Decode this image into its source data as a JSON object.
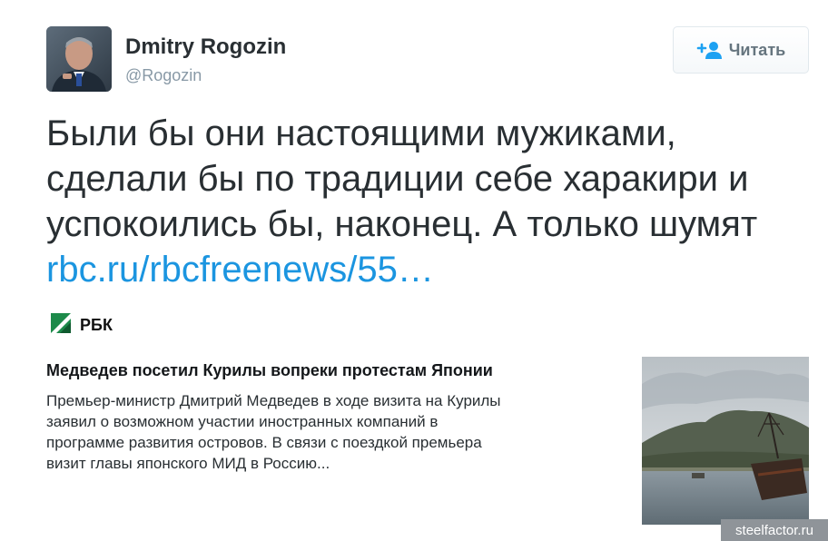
{
  "profile": {
    "display_name": "Dmitry Rogozin",
    "handle": "@Rogozin"
  },
  "follow_button": {
    "label": "Читать",
    "icon": "follow-person-plus-icon"
  },
  "tweet": {
    "lines": [
      "Были бы они настоящими мужиками,",
      "сделали бы по традиции себе харакири и",
      "успокоились бы, наконец. А только шумят"
    ],
    "link_text": "rbc.ru/rbcfreenews/55…"
  },
  "card": {
    "source_name": "РБК",
    "title": "Медведев посетил Курилы вопреки протестам Японии",
    "description_lines": [
      "Премьер-министр Дмитрий Медведев в ходе визита на Курилы",
      "заявил о возможном участии иностранных компаний в",
      "программе развития островов. В связи с поездкой премьера",
      "визит главы японского МИД в Россию..."
    ]
  },
  "watermark": "steelfactor.ru",
  "colors": {
    "link": "#1b95e0",
    "text": "#292f33",
    "secondary": "#8899a6",
    "follow_icon": "#1da1f2",
    "rbc_green": "#1d8a4a"
  }
}
